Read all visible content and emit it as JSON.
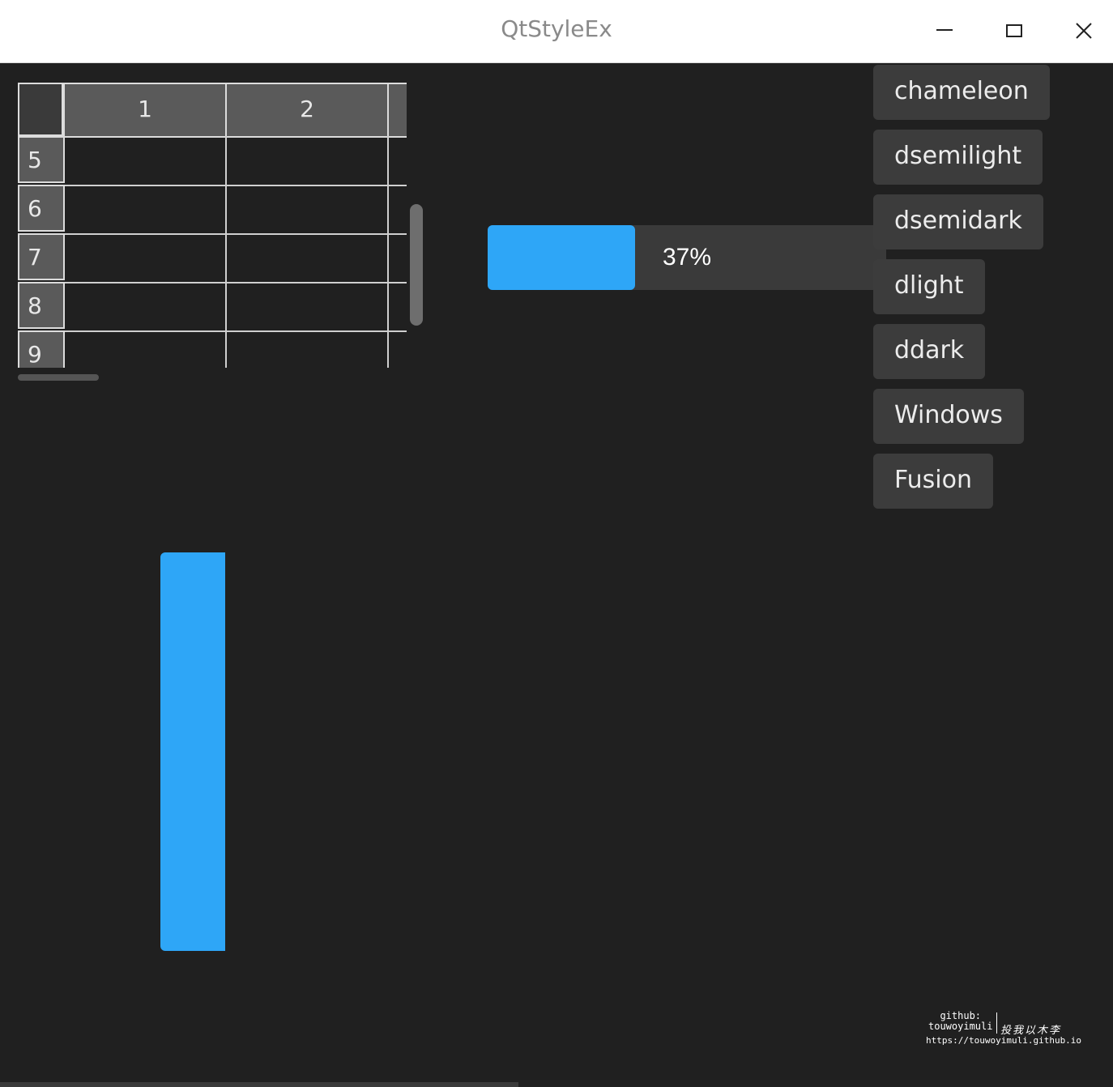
{
  "window": {
    "title": "QtStyleEx"
  },
  "table": {
    "columns": [
      "1",
      "2"
    ],
    "rows": [
      "5",
      "6",
      "7",
      "8",
      "9"
    ]
  },
  "progress": {
    "value": 0.37,
    "label": "37%"
  },
  "styles": [
    "chameleon",
    "dsemilight",
    "dsemidark",
    "dlight",
    "ddark",
    "Windows",
    "Fusion"
  ],
  "watermark": {
    "line1": "github:",
    "line2": "touwoyimuli",
    "url": "https://touwoyimuli.github.io",
    "signature": "投我以木李"
  },
  "colors": {
    "accent": "#2ea6f7",
    "background": "#202020",
    "button": "#3c3c3c"
  }
}
